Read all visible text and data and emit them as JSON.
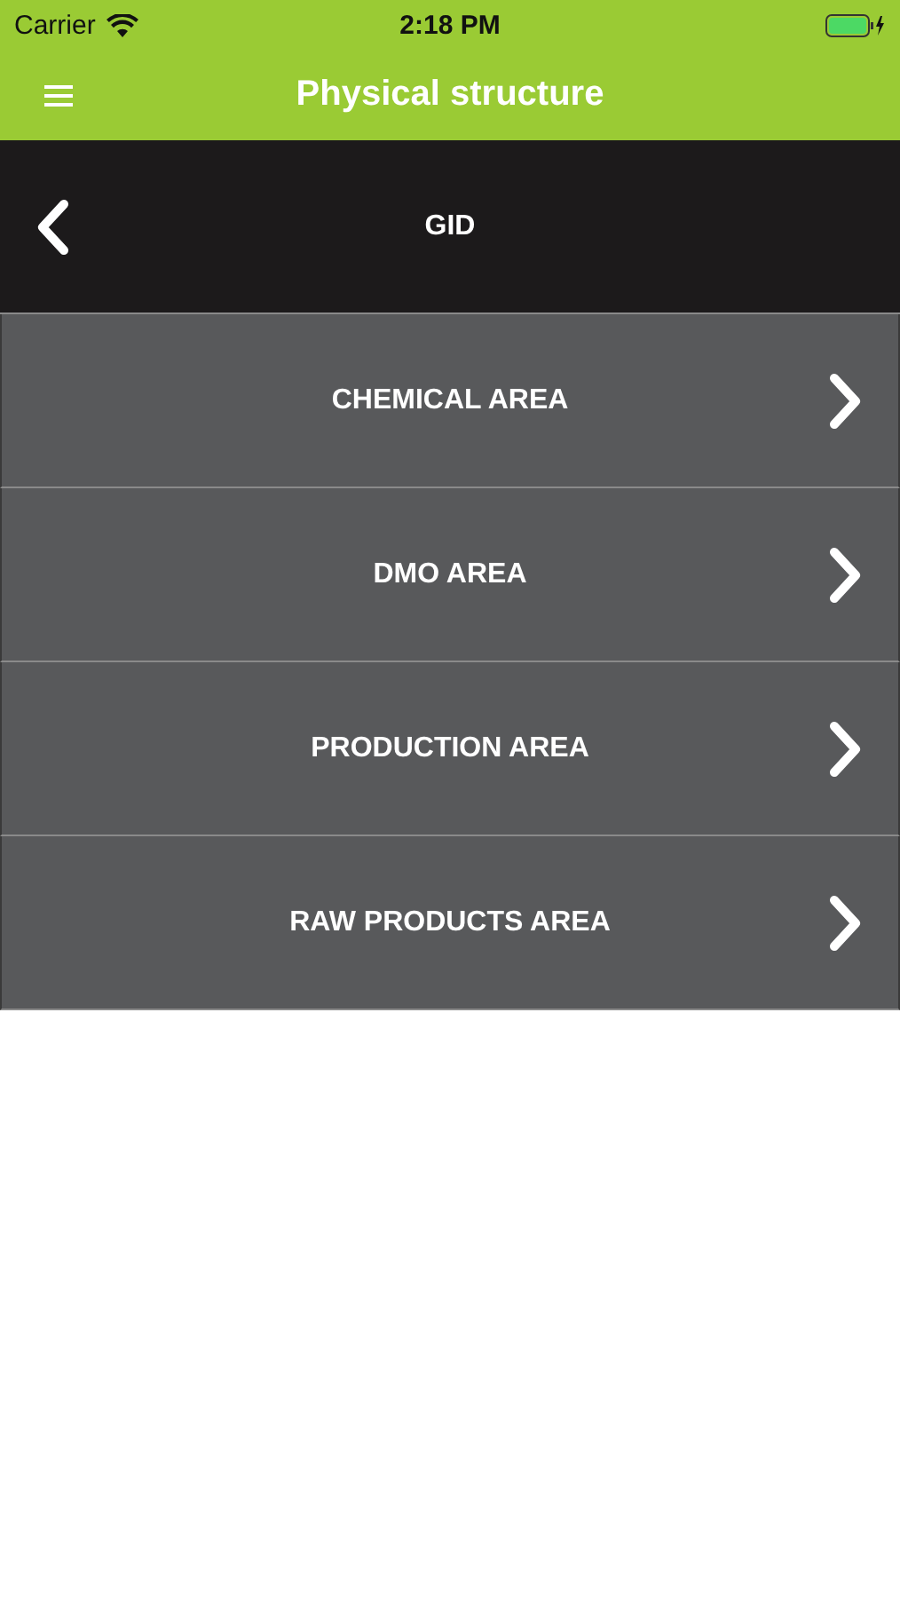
{
  "status_bar": {
    "carrier": "Carrier",
    "time": "2:18 PM"
  },
  "nav_bar": {
    "title": "Physical structure"
  },
  "header": {
    "title": "GID"
  },
  "areas": [
    {
      "label": "CHEMICAL AREA"
    },
    {
      "label": "DMO AREA"
    },
    {
      "label": "PRODUCTION AREA"
    },
    {
      "label": "RAW PRODUCTS AREA"
    }
  ]
}
